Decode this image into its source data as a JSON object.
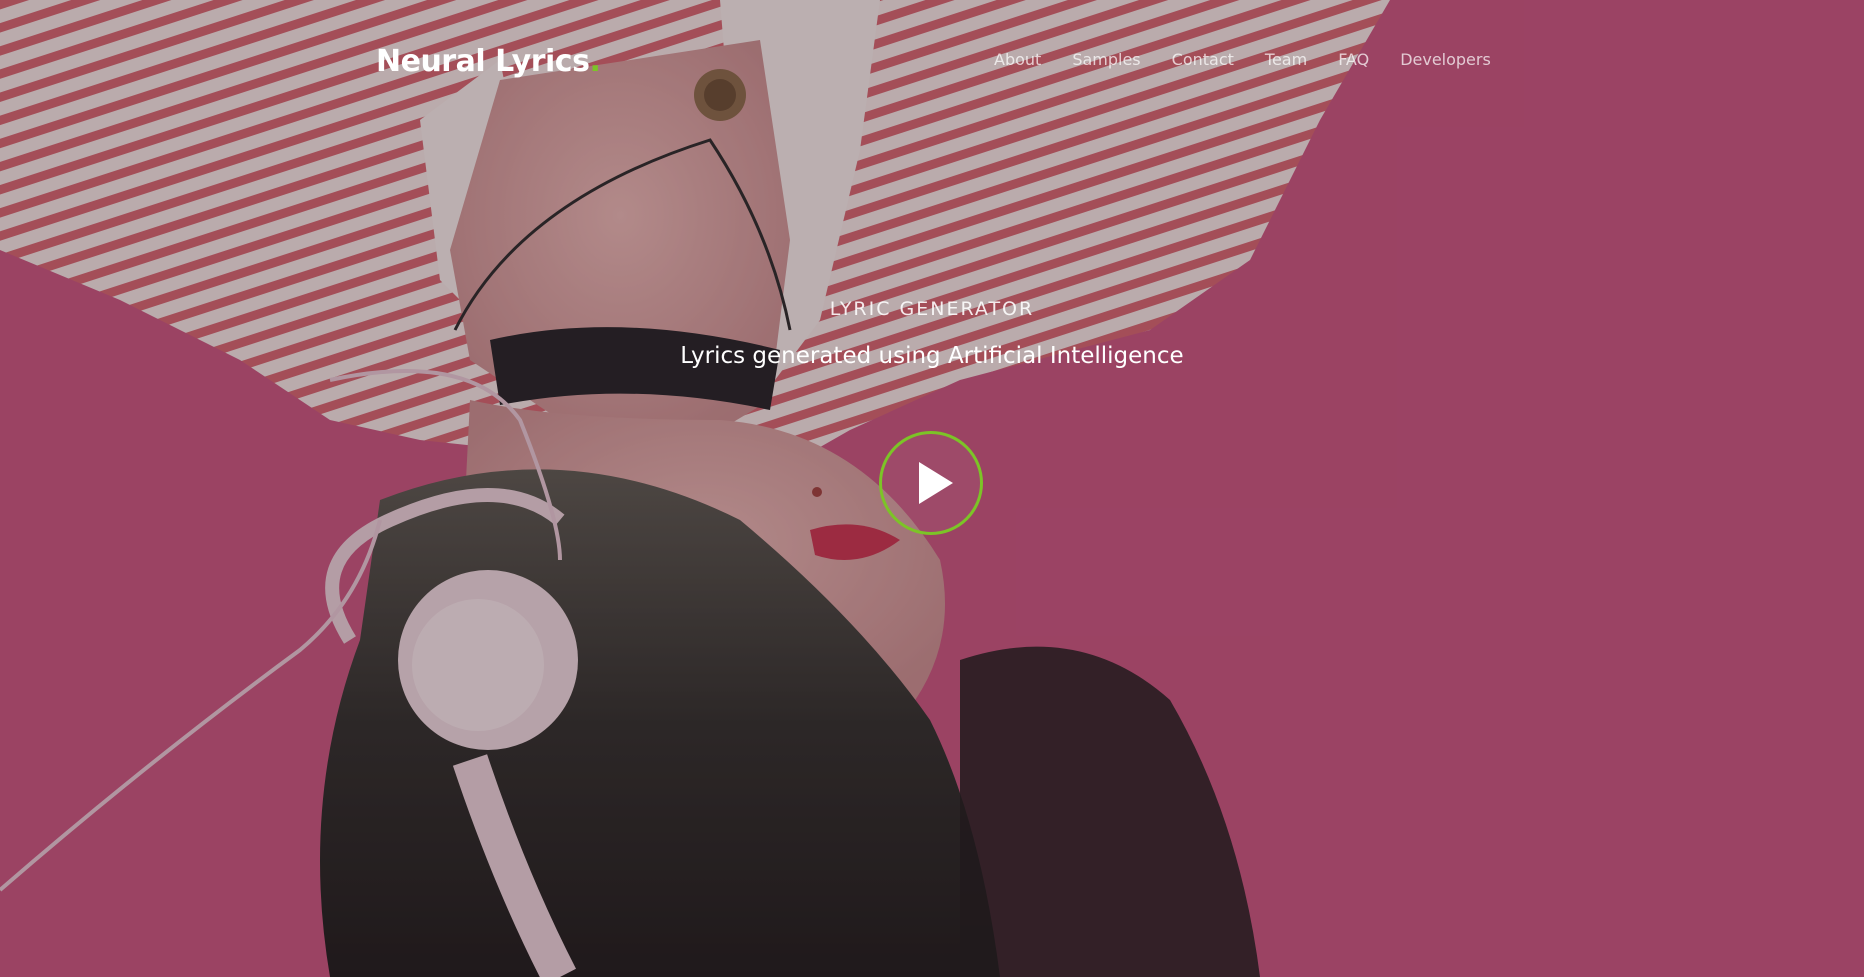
{
  "brand": {
    "name": "Neural Lyrics",
    "dot": ".",
    "accent_color": "#7cc427"
  },
  "nav": {
    "items": [
      {
        "label": "About"
      },
      {
        "label": "Samples"
      },
      {
        "label": "Contact"
      },
      {
        "label": "Team"
      },
      {
        "label": "FAQ"
      },
      {
        "label": "Developers"
      }
    ]
  },
  "hero": {
    "eyebrow": "LYRIC GENERATOR",
    "tagline": "Lyrics generated using Artificial Intelligence",
    "play_icon": "play-icon",
    "background_color": "#c8557f"
  }
}
